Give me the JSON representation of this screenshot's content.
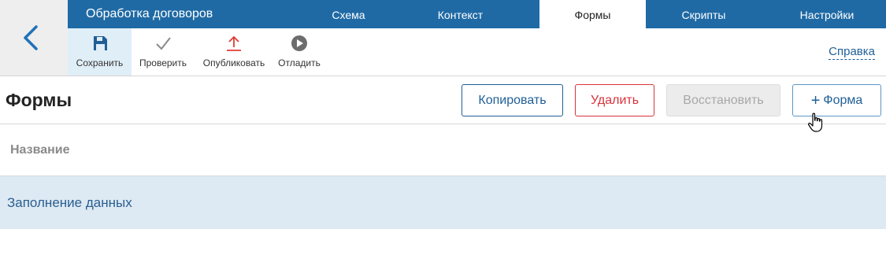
{
  "navigation": {
    "back_icon": "chevron-left-icon"
  },
  "header": {
    "app_title": "Обработка договоров",
    "tabs": [
      {
        "label": "Схема",
        "active": false
      },
      {
        "label": "Контекст",
        "active": false
      },
      {
        "label": "Формы",
        "active": true
      },
      {
        "label": "Скрипты",
        "active": false
      },
      {
        "label": "Настройки",
        "active": false
      }
    ]
  },
  "toolbar": {
    "items": [
      {
        "label": "Сохранить",
        "icon": "save-icon",
        "active": true
      },
      {
        "label": "Проверить",
        "icon": "checkmark-icon",
        "active": false
      },
      {
        "label": "Опубликовать",
        "icon": "upload-icon",
        "active": false
      },
      {
        "label": "Отладить",
        "icon": "play-icon",
        "active": false
      }
    ],
    "help_label": "Справка"
  },
  "page": {
    "title": "Формы",
    "buttons": {
      "copy": "Копировать",
      "delete": "Удалить",
      "restore": "Восстановить",
      "add_form": "Форма"
    }
  },
  "table": {
    "columns": [
      "Название"
    ],
    "rows": [
      {
        "name": "Заполнение данных",
        "selected": true
      }
    ]
  },
  "colors": {
    "brand_blue": "#1f6aa5",
    "link_blue": "#1f5f96",
    "danger_red": "#d8333b",
    "selected_row": "#dde9f3",
    "upload_icon_red": "#e03b34"
  }
}
